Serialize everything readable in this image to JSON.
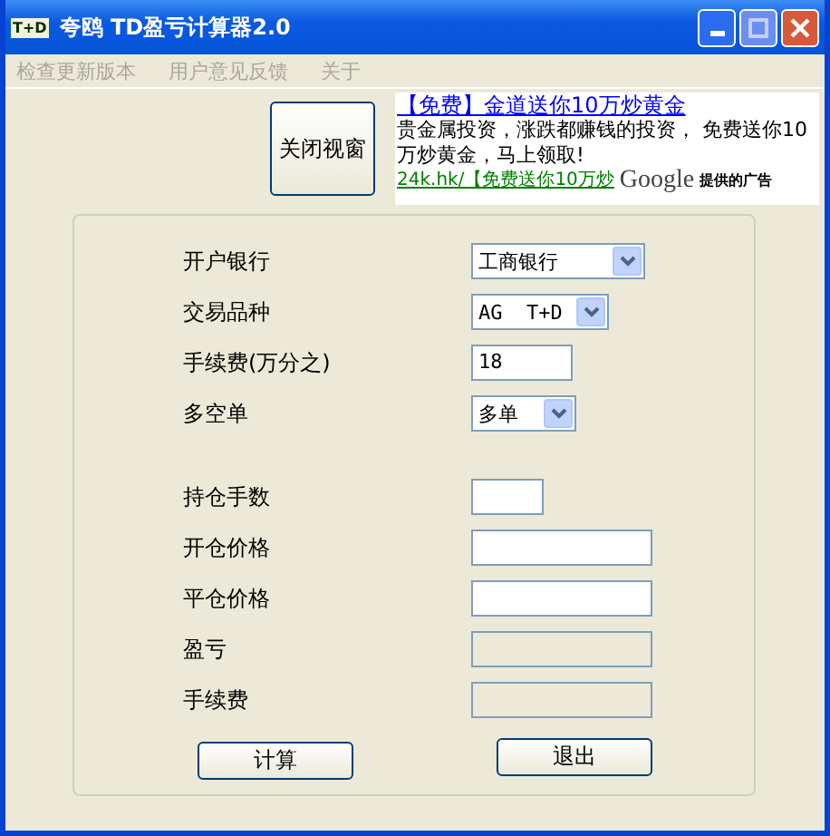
{
  "window": {
    "icon_text": "T+D",
    "title": "夸鸥 TD盈亏计算器2.0"
  },
  "menu": [
    {
      "label": "检查更新版本",
      "disabled": true
    },
    {
      "label": "用户意见反馈",
      "disabled": true
    },
    {
      "label": "关于",
      "disabled": true
    }
  ],
  "close_view_button": "关闭视窗",
  "ad": {
    "title": "【免费】金道送你10万炒黄金",
    "body": "贵金属投资，涨跌都赚钱的投资， 免费送你10万炒黄金，马上领取!",
    "url": "24k.hk/【免费送你10万炒",
    "brand": "Google",
    "brand_note": "提供的广告"
  },
  "form": [
    {
      "label": "开户银行",
      "kind": "select",
      "value": "工商银行"
    },
    {
      "label": "交易品种",
      "kind": "select",
      "value": "AG  T+D"
    },
    {
      "label": "手续费(万分之)",
      "kind": "text",
      "value": "18",
      "disabled": false
    },
    {
      "label": "多空单",
      "kind": "select",
      "value": "多单"
    },
    {
      "kind": "spacer"
    },
    {
      "label": "持仓手数",
      "kind": "text",
      "disabled": false
    },
    {
      "label": "开仓价格",
      "kind": "text",
      "disabled": false
    },
    {
      "label": "平仓价格",
      "kind": "text",
      "disabled": false
    },
    {
      "label": "盈亏",
      "kind": "text",
      "disabled": true
    },
    {
      "label": "手续费",
      "kind": "text",
      "disabled": true
    }
  ],
  "buttons": [
    "计算",
    "退出"
  ]
}
